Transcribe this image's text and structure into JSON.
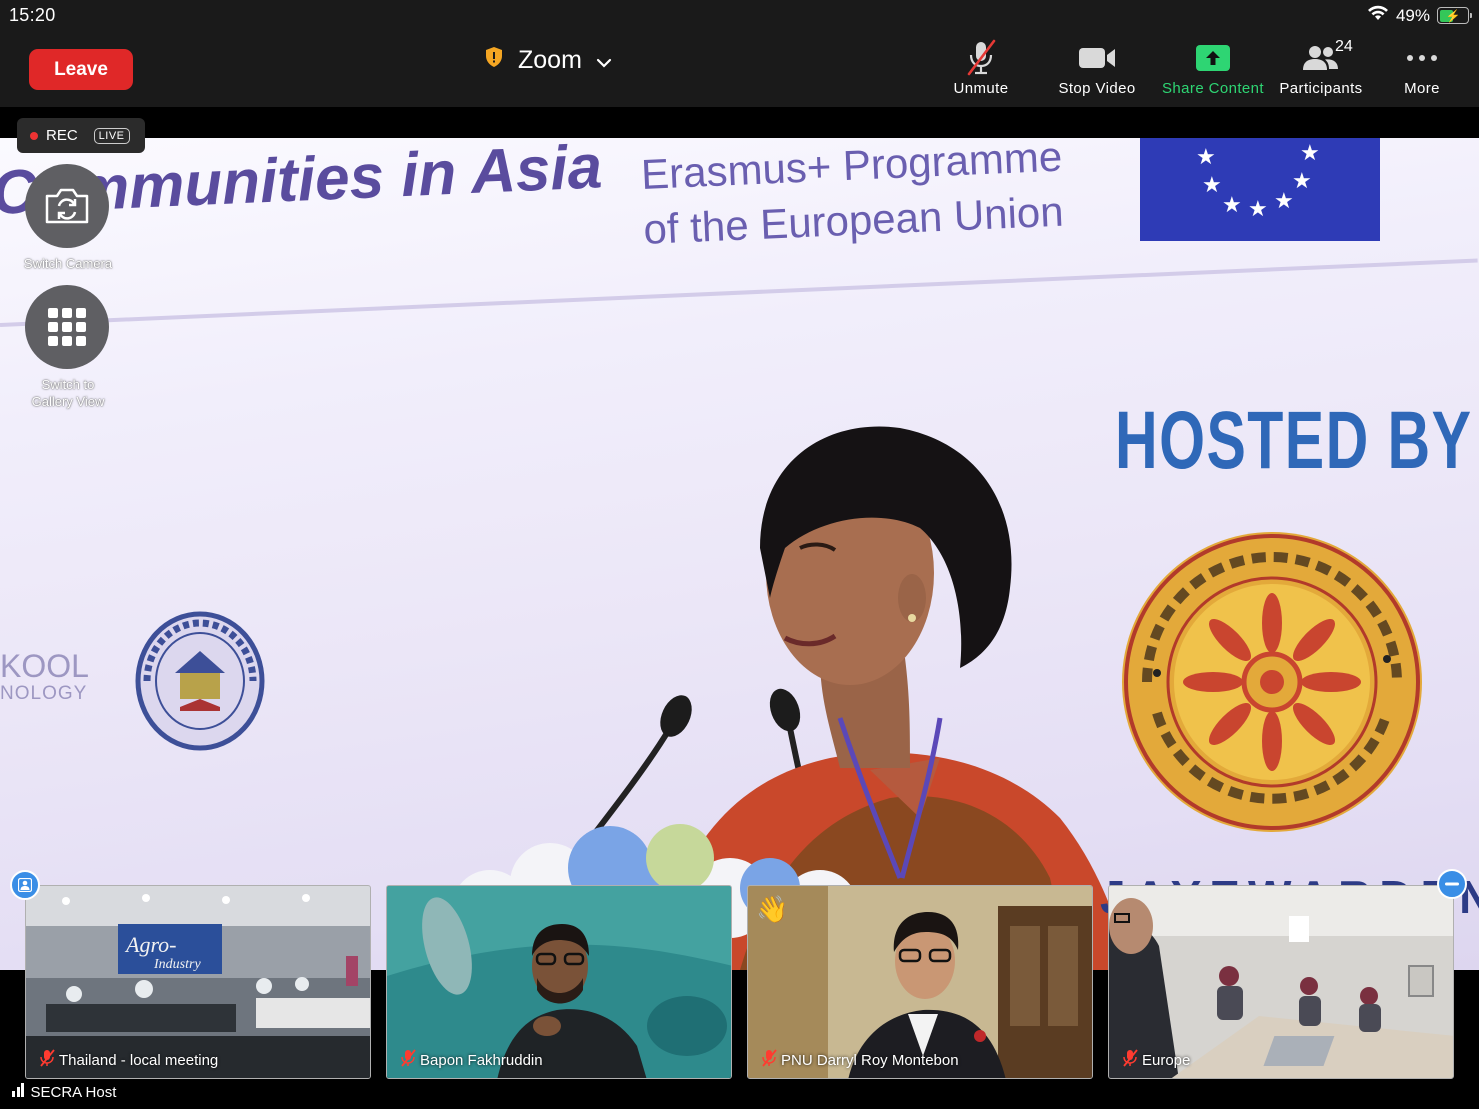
{
  "status_bar": {
    "time": "15:20",
    "battery_percent": "49%",
    "battery_level": 0.49
  },
  "toolbar": {
    "leave_label": "Leave",
    "meeting_title": "Zoom",
    "unmute_label": "Unmute",
    "stop_video_label": "Stop Video",
    "share_label": "Share Content",
    "participants_label": "Participants",
    "participants_count": "24",
    "more_label": "More"
  },
  "recording": {
    "rec_label": "REC",
    "live_label": "LIVE"
  },
  "floating": {
    "switch_camera_label": "Switch Camera",
    "gallery_label_line1": "Switch to",
    "gallery_label_line2": "Gallery View"
  },
  "banner": {
    "headline": "Communities in Asia",
    "erasmus_line1": "Erasmus+ Programme",
    "erasmus_line2": "of the European Union",
    "hosted_by": "HOSTED BY",
    "left_text_line1": "KOOL",
    "left_text_line2": "NOLOGY",
    "bottom_text": "JAYEWARDENEPURA"
  },
  "thumbnails": [
    {
      "name": "Thailand - local meeting"
    },
    {
      "name": "Bapon Fakhruddin"
    },
    {
      "name": "PNU Darryl Roy Montebon"
    },
    {
      "name": "Europe"
    }
  ],
  "footer": {
    "host_label": "SECRA Host"
  },
  "colors": {
    "leave": "#e02828",
    "share": "#2ed573",
    "toolbar_bg": "#1a1a1a",
    "corner_button": "#3a8ee6"
  }
}
